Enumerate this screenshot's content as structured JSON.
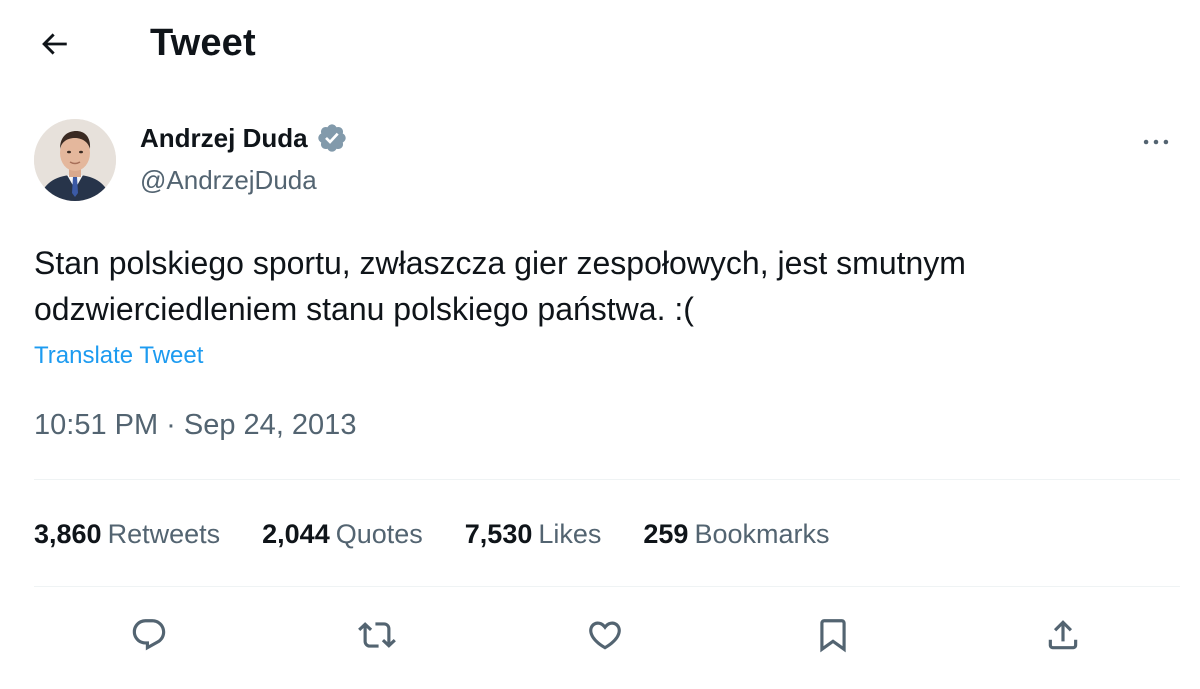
{
  "header": {
    "title": "Tweet",
    "back_icon": "arrow-left-icon"
  },
  "author": {
    "name": "Andrzej Duda",
    "handle": "@AndrzejDuda",
    "verified_icon": "verified-badge-icon",
    "verified_color": "#829aab"
  },
  "more_icon": "more-horizontal-icon",
  "tweet": {
    "text_line1": "Stan polskiego sportu, zwłaszcza gier zespołowych, jest smutnym",
    "text_line2": "odzwierciedleniem stanu polskiego państwa. :(",
    "translate_label": "Translate Tweet",
    "timestamp": "10:51 PM · Sep 24, 2013"
  },
  "stats": [
    {
      "count": "3,860",
      "label": "Retweets"
    },
    {
      "count": "2,044",
      "label": "Quotes"
    },
    {
      "count": "7,530",
      "label": "Likes"
    },
    {
      "count": "259",
      "label": "Bookmarks"
    }
  ],
  "actions": [
    "reply-icon",
    "retweet-icon",
    "like-icon",
    "bookmark-icon",
    "share-icon"
  ],
  "colors": {
    "text": "#0f1419",
    "secondary": "#536471",
    "link": "#1d9bf0",
    "divider": "#eff3f4"
  }
}
